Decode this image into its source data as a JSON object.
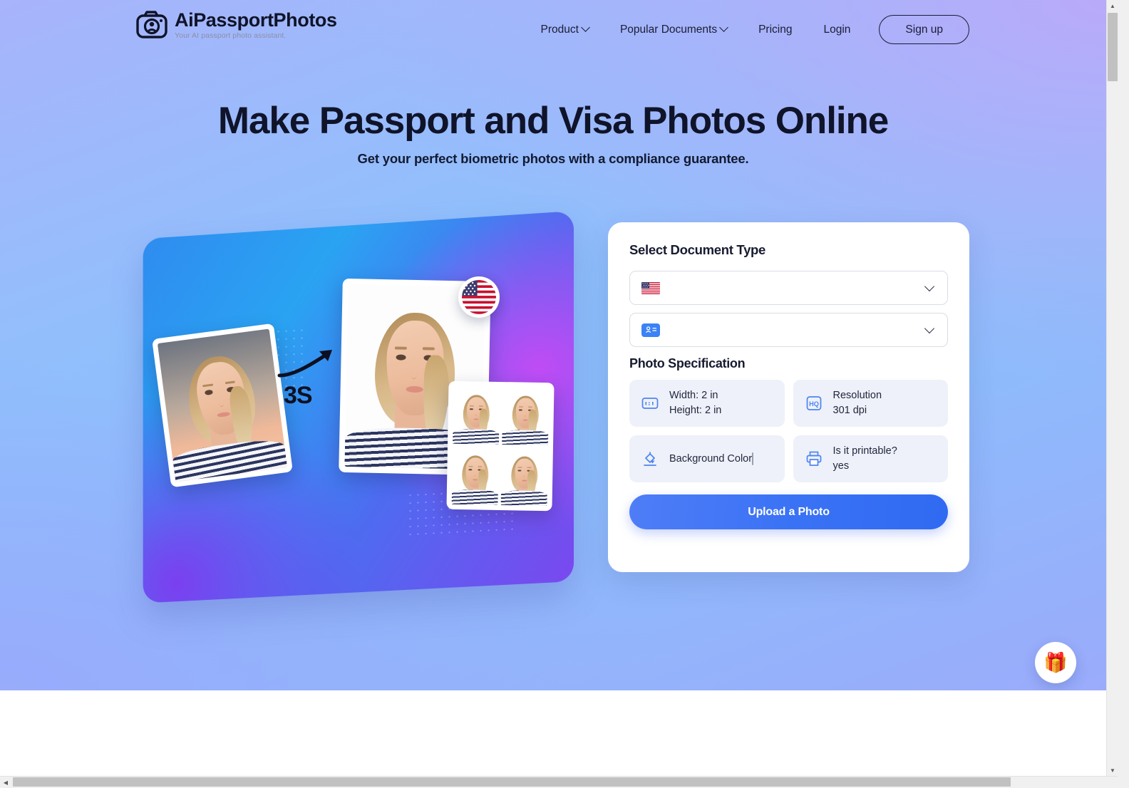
{
  "brand": {
    "name": "AiPassportPhotos",
    "tagline": "Your AI passport photo assistant.",
    "icon": "camera-icon"
  },
  "nav": {
    "items": [
      {
        "label": "Product",
        "has_chevron": true
      },
      {
        "label": "Popular Documents",
        "has_chevron": true
      },
      {
        "label": "Pricing",
        "has_chevron": false
      },
      {
        "label": "Login",
        "has_chevron": false
      }
    ],
    "signup_label": "Sign up"
  },
  "hero": {
    "headline": "Make Passport and Visa Photos Online",
    "subhead": "Get your perfect biometric photos with a compliance guarantee.",
    "illustration": {
      "time_badge": "3S",
      "flag_badge_icon": "us-flag-icon",
      "before_photo_alt": "original photo",
      "after_photo_alt": "compliant passport photo",
      "sheet_alt": "printable photo sheet 2x2"
    }
  },
  "form": {
    "title": "Select Document Type",
    "country_select": {
      "value": "",
      "icon": "us-flag-icon",
      "placeholder": ""
    },
    "document_select": {
      "value": "",
      "icon": "id-card-icon",
      "placeholder": ""
    },
    "spec_title": "Photo Specification",
    "specs": [
      {
        "icon": "aspect-ratio-icon",
        "icon_label": "1:1",
        "line1": "Width: 2 in",
        "line2": "Height: 2 in",
        "type": "text"
      },
      {
        "icon": "hq-icon",
        "icon_label": "HQ",
        "line1": "Resolution",
        "line2": "301 dpi",
        "type": "text"
      },
      {
        "icon": "paint-bucket-icon",
        "icon_label": "",
        "line1": "Background Color",
        "line2": "",
        "type": "swatch",
        "swatch_color": "#ffffff"
      },
      {
        "icon": "printer-icon",
        "icon_label": "",
        "line1": "Is it printable?",
        "line2": "yes",
        "type": "text"
      }
    ],
    "upload_label": "Upload a Photo"
  },
  "fab": {
    "icon": "gift-icon",
    "glyph": "🎁"
  },
  "colors": {
    "accent_blue": "#3b73f5",
    "bg_gradient_start": "#b9aaf9",
    "bg_gradient_end": "#8cbdfb",
    "text_dark": "#10142a",
    "spec_tile_bg": "#eef1f9",
    "illus_panel_start": "#2f8cf0",
    "illus_panel_end": "#7a48ef"
  }
}
